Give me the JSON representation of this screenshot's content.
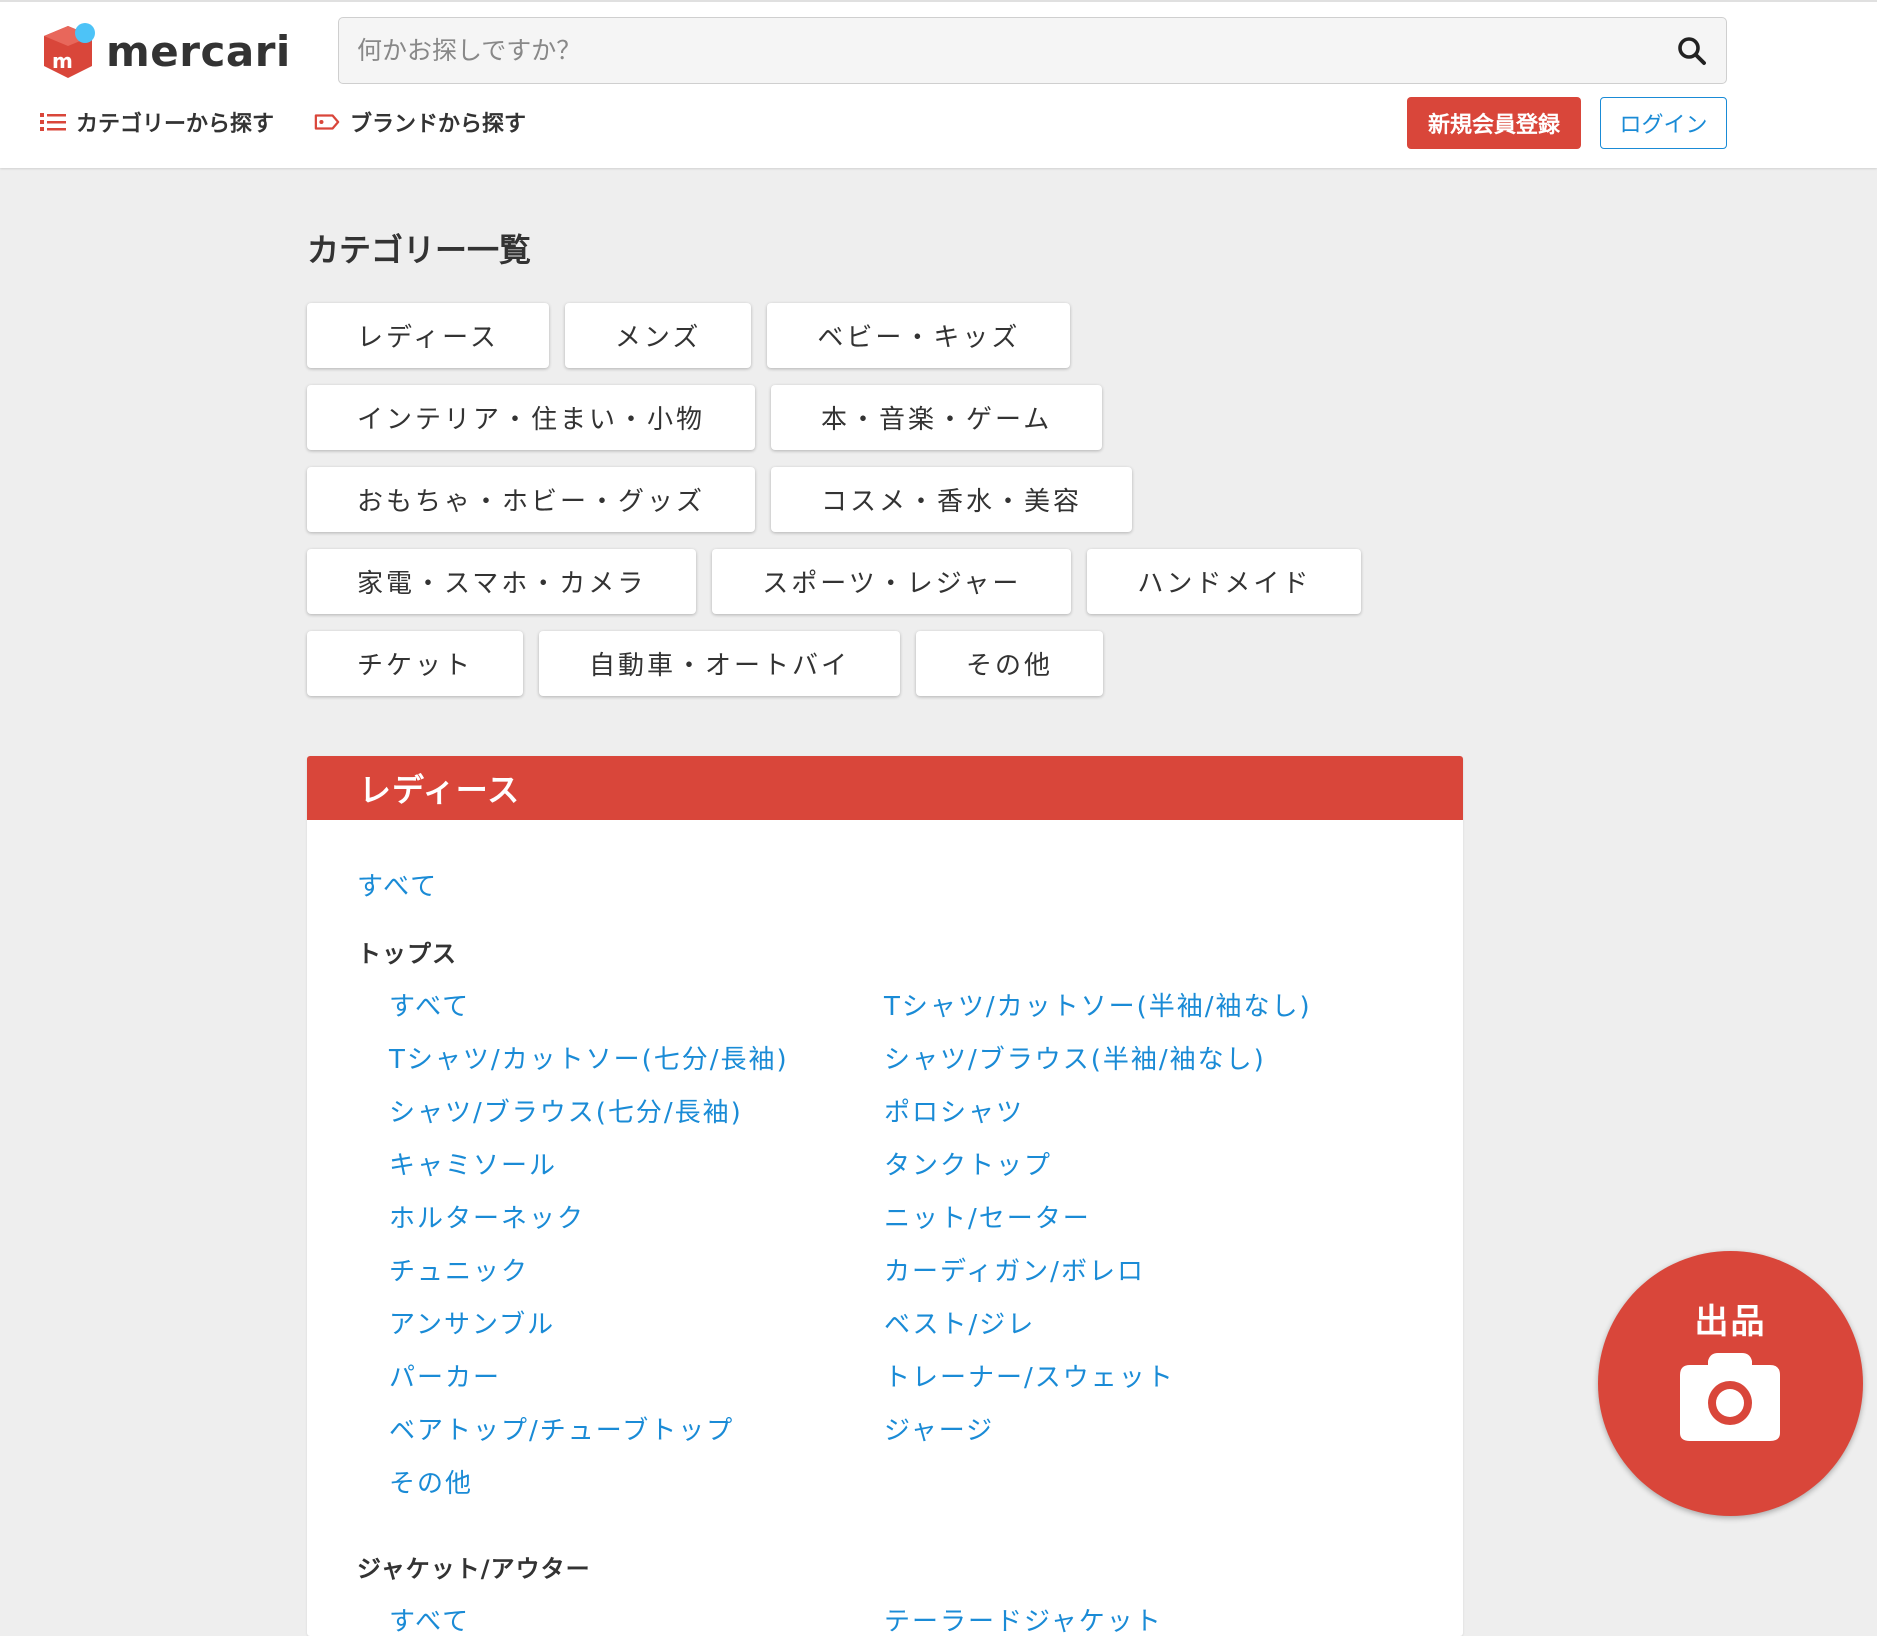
{
  "brand": {
    "name": "mercari",
    "colors": {
      "primary": "#d9463a",
      "link": "#1a8bd6",
      "logo_dot": "#4dc3f7"
    }
  },
  "search": {
    "placeholder": "何かお探しですか？",
    "value": "",
    "icon": "search-icon"
  },
  "nav": {
    "category_label": "カテゴリーから探す",
    "category_icon": "list-icon",
    "brand_label": "ブランドから探す",
    "brand_icon": "tag-icon"
  },
  "auth": {
    "register_label": "新規会員登録",
    "login_label": "ログイン"
  },
  "page_title": "カテゴリー一覧",
  "categories": [
    "レディース",
    "メンズ",
    "ベビー・キッズ",
    "インテリア・住まい・小物",
    "本・音楽・ゲーム",
    "おもちゃ・ホビー・グッズ",
    "コスメ・香水・美容",
    "家電・スマホ・カメラ",
    "スポーツ・レジャー",
    "ハンドメイド",
    "チケット",
    "自動車・オートバイ",
    "その他"
  ],
  "section": {
    "title": "レディース",
    "all_link": "すべて",
    "groups": [
      {
        "title": "トップス",
        "links": [
          "すべて",
          "Tシャツ/カットソー(半袖/袖なし)",
          "Tシャツ/カットソー(七分/長袖)",
          "シャツ/ブラウス(半袖/袖なし)",
          "シャツ/ブラウス(七分/長袖)",
          "ポロシャツ",
          "キャミソール",
          "タンクトップ",
          "ホルターネック",
          "ニット/セーター",
          "チュニック",
          "カーディガン/ボレロ",
          "アンサンブル",
          "ベスト/ジレ",
          "パーカー",
          "トレーナー/スウェット",
          "ベアトップ/チューブトップ",
          "ジャージ",
          "その他"
        ]
      },
      {
        "title": "ジャケット/アウター",
        "links": [
          "すべて",
          "テーラードジャケット"
        ]
      }
    ]
  },
  "fab": {
    "label": "出品",
    "icon": "camera-icon"
  }
}
